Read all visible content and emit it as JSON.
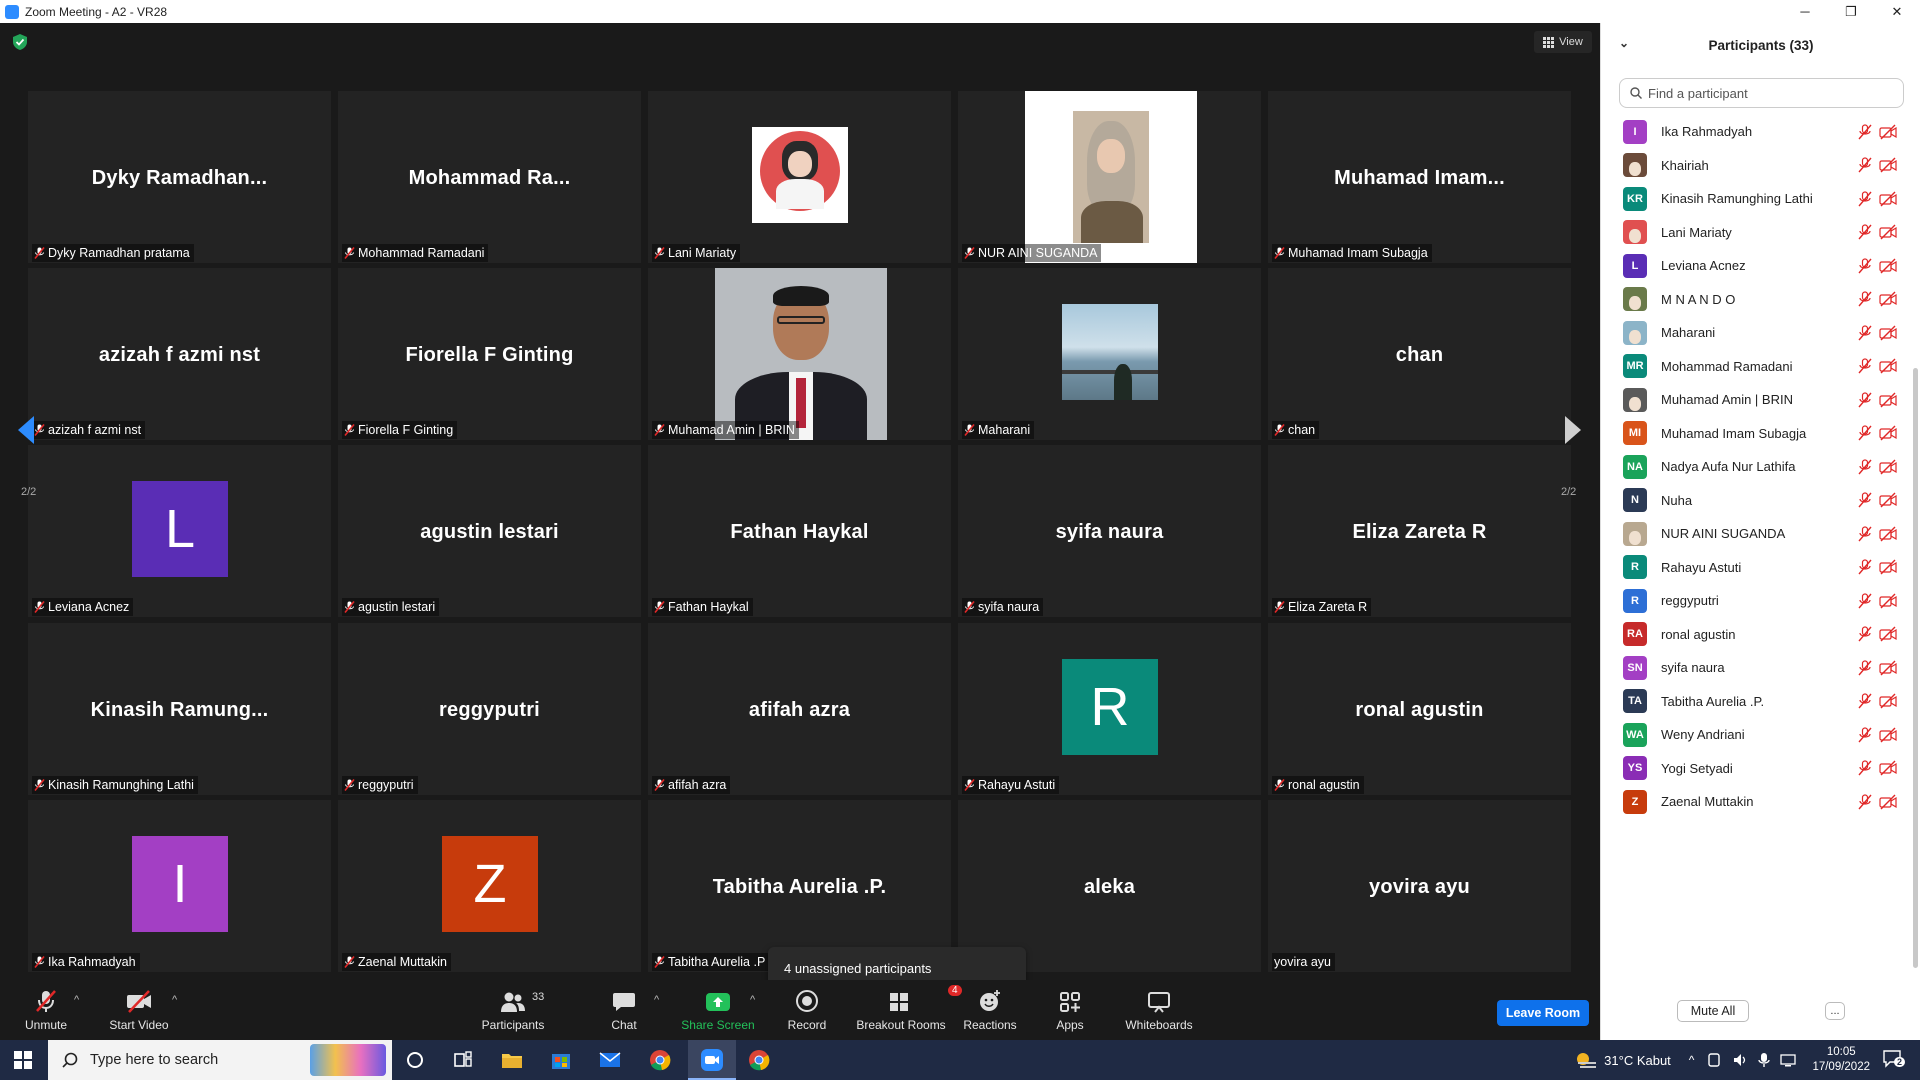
{
  "window": {
    "title": "Zoom Meeting - A2 - VR28",
    "minimize": "─",
    "maximize": "❐",
    "close": "✕"
  },
  "view_button": "View",
  "pager": {
    "left": "2/2",
    "right": "2/2"
  },
  "tiles": [
    {
      "big": "Dyky  Ramadhan...",
      "label": "Dyky Ramadhan pratama"
    },
    {
      "big": "Mohammad  Ra...",
      "label": "Mohammad Ramadani"
    },
    {
      "big": "",
      "label": "Lani Mariaty",
      "photo": "lani"
    },
    {
      "big": "",
      "label": "NUR AINI SUGANDA",
      "photo": "nur"
    },
    {
      "big": "Muhamad  Imam...",
      "label": "Muhamad Imam Subagja"
    },
    {
      "big": "azizah f azmi nst",
      "label": "azizah f azmi nst"
    },
    {
      "big": "Fiorella F Ginting",
      "label": "Fiorella F Ginting"
    },
    {
      "big": "",
      "label": "Muhamad Amin | BRIN",
      "photo": "amin"
    },
    {
      "big": "",
      "label": "Maharani",
      "photo": "maharani"
    },
    {
      "big": "chan",
      "label": "chan"
    },
    {
      "big": "",
      "label": "Leviana Acnez",
      "avatar": "L",
      "color": "#5a2db5"
    },
    {
      "big": "agustin lestari",
      "label": "agustin lestari"
    },
    {
      "big": "Fathan Haykal",
      "label": "Fathan Haykal"
    },
    {
      "big": "syifa naura",
      "label": "syifa naura"
    },
    {
      "big": "Eliza Zareta R",
      "label": "Eliza Zareta R"
    },
    {
      "big": "Kinasih  Ramung...",
      "label": "Kinasih Ramunghing Lathi"
    },
    {
      "big": "reggyputri",
      "label": "reggyputri"
    },
    {
      "big": "afifah azra",
      "label": "afifah azra"
    },
    {
      "big": "",
      "label": "Rahayu Astuti",
      "avatar": "R",
      "color": "#0a8a7a"
    },
    {
      "big": "ronal agustin",
      "label": "ronal agustin"
    },
    {
      "big": "",
      "label": "Ika Rahmadyah",
      "avatar": "I",
      "color": "#a33fc4"
    },
    {
      "big": "",
      "label": "Zaenal Muttakin",
      "avatar": "Z",
      "color": "#c73b0c"
    },
    {
      "big": "Tabitha Aurelia .P.",
      "label": "Tabitha Aurelia .P"
    },
    {
      "big": "aleka",
      "label": ""
    },
    {
      "big": "yovira ayu",
      "label": "yovira ayu",
      "nomute": true
    }
  ],
  "toast": "4 unassigned participants",
  "toolbar": {
    "unmute": "Unmute",
    "start_video": "Start Video",
    "participants": "Participants",
    "participants_count": "33",
    "chat": "Chat",
    "share_screen": "Share Screen",
    "record": "Record",
    "breakout_rooms": "Breakout Rooms",
    "breakout_badge": "4",
    "reactions": "Reactions",
    "apps": "Apps",
    "whiteboards": "Whiteboards",
    "leave_room": "Leave Room"
  },
  "panel": {
    "title": "Participants (33)",
    "search_placeholder": "Find a participant",
    "mute_all": "Mute All",
    "more": "...",
    "participants": [
      {
        "name": "Ika Rahmadyah",
        "initials": "I",
        "color": "#a33fc4"
      },
      {
        "name": "Khairiah",
        "initials": "",
        "color": "#6b4b3a",
        "photo": true
      },
      {
        "name": "Kinasih Ramunghing Lathi",
        "initials": "KR",
        "color": "#0a8a7a"
      },
      {
        "name": "Lani Mariaty",
        "initials": "",
        "color": "#e05050",
        "photo": true
      },
      {
        "name": "Leviana Acnez",
        "initials": "L",
        "color": "#5a2db5"
      },
      {
        "name": "M N A N D O",
        "initials": "",
        "color": "#6a7a4a",
        "photo": true
      },
      {
        "name": "Maharani",
        "initials": "",
        "color": "#8cb4c8",
        "photo": true
      },
      {
        "name": "Mohammad Ramadani",
        "initials": "MR",
        "color": "#0a8a7a"
      },
      {
        "name": "Muhamad Amin | BRIN",
        "initials": "",
        "color": "#5a5a5a",
        "photo": true
      },
      {
        "name": "Muhamad Imam Subagja",
        "initials": "MI",
        "color": "#d9541a"
      },
      {
        "name": "Nadya Aufa Nur Lathifa",
        "initials": "NA",
        "color": "#1aa35a"
      },
      {
        "name": "Nuha",
        "initials": "N",
        "color": "#2b3a55"
      },
      {
        "name": "NUR AINI SUGANDA",
        "initials": "",
        "color": "#b8a890",
        "photo": true
      },
      {
        "name": "Rahayu Astuti",
        "initials": "R",
        "color": "#0a8a7a"
      },
      {
        "name": "reggyputri",
        "initials": "R",
        "color": "#2d6fd6"
      },
      {
        "name": "ronal agustin",
        "initials": "RA",
        "color": "#c62a2a"
      },
      {
        "name": "syifa naura",
        "initials": "SN",
        "color": "#a33fc4"
      },
      {
        "name": "Tabitha Aurelia .P.",
        "initials": "TA",
        "color": "#2b3a55"
      },
      {
        "name": "Weny Andriani",
        "initials": "WA",
        "color": "#1aa35a"
      },
      {
        "name": "Yogi Setyadi",
        "initials": "YS",
        "color": "#8a2db5"
      },
      {
        "name": "Zaenal Muttakin",
        "initials": "Z",
        "color": "#c73b0c"
      }
    ]
  },
  "taskbar": {
    "search_placeholder": "Type here to search",
    "weather": "31°C  Kabut",
    "time": "10:05",
    "date": "17/09/2022",
    "notification_count": "2"
  }
}
